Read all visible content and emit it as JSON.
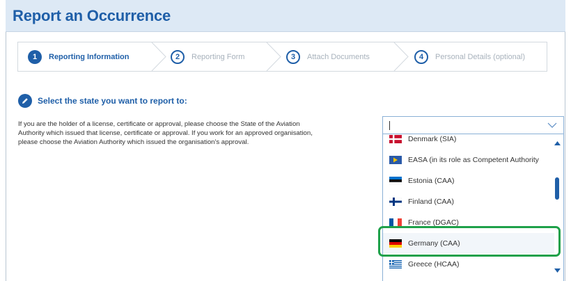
{
  "header": {
    "title": "Report an Occurrence"
  },
  "steps": [
    {
      "number": "1",
      "label": "Reporting Information"
    },
    {
      "number": "2",
      "label": "Reporting Form"
    },
    {
      "number": "3",
      "label": "Attach Documents"
    },
    {
      "number": "4",
      "label": "Personal Details (optional)"
    }
  ],
  "section": {
    "title": "Select the state you want to report to:",
    "description_lines": [
      "If you are the holder of a license, certificate or approval, please choose the State of the Aviation",
      "Authority which issued that license, certificate or approval. If you work for an approved organisation,",
      "please choose the Aviation Authority which issued the organisation's approval."
    ]
  },
  "dropdown": {
    "value": "",
    "selected": "Germany (CAA)",
    "options": [
      {
        "label": "Denmark (SIA)",
        "flag": "dk"
      },
      {
        "label": "EASA (in its role as Competent Authority",
        "flag": "eu"
      },
      {
        "label": "Estonia (CAA)",
        "flag": "ee"
      },
      {
        "label": "Finland (CAA)",
        "flag": "fi"
      },
      {
        "label": "France (DGAC)",
        "flag": "fr"
      },
      {
        "label": "Germany (CAA)",
        "flag": "de"
      },
      {
        "label": "Greece (HCAA)",
        "flag": "gr"
      }
    ],
    "scroll_position": 0.35
  },
  "colors": {
    "accent": "#1f5fa8",
    "highlight": "#1ea14a",
    "header_bg": "#dde9f5"
  }
}
